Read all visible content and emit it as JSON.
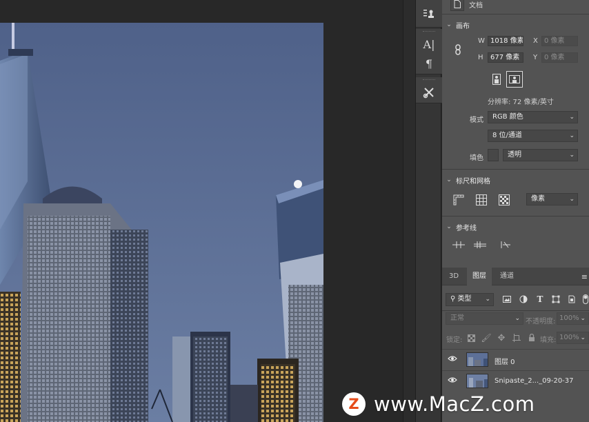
{
  "panel": {
    "doc_label": "文档",
    "canvas_header": "画布",
    "w_label": "W",
    "w_value": "1018 像素",
    "h_label": "H",
    "h_value": "677 像素",
    "x_label": "X",
    "x_placeholder": "0 像素",
    "y_label": "Y",
    "y_placeholder": "0 像素",
    "resolution": "分辨率: 72 像素/英寸",
    "mode_label": "模式",
    "mode_value": "RGB 颜色",
    "depth_value": "8 位/通道",
    "fill_label": "填色",
    "fill_value": "透明",
    "rulers_header": "标尺和网格",
    "units_value": "像素",
    "guides_header": "参考线"
  },
  "layers": {
    "tabs": [
      {
        "label": "3D"
      },
      {
        "label": "图层"
      },
      {
        "label": "通道"
      }
    ],
    "filter_value": "类型",
    "blend_value": "正常",
    "opacity_label": "不透明度:",
    "opacity_value": "100%",
    "lock_label": "锁定:",
    "fill_label": "填充:",
    "fill_value": "100%",
    "items": [
      {
        "name": "图层 0"
      },
      {
        "name": "Snipaste_2..._09-20-37"
      }
    ]
  },
  "watermark": {
    "logo_letter": "Z",
    "text": "www.MacZ.com"
  },
  "colors": {
    "panel_bg": "#535353",
    "workspace_bg": "#282828",
    "sky": "#5d7098",
    "watermark_accent": "#e64c1a"
  }
}
